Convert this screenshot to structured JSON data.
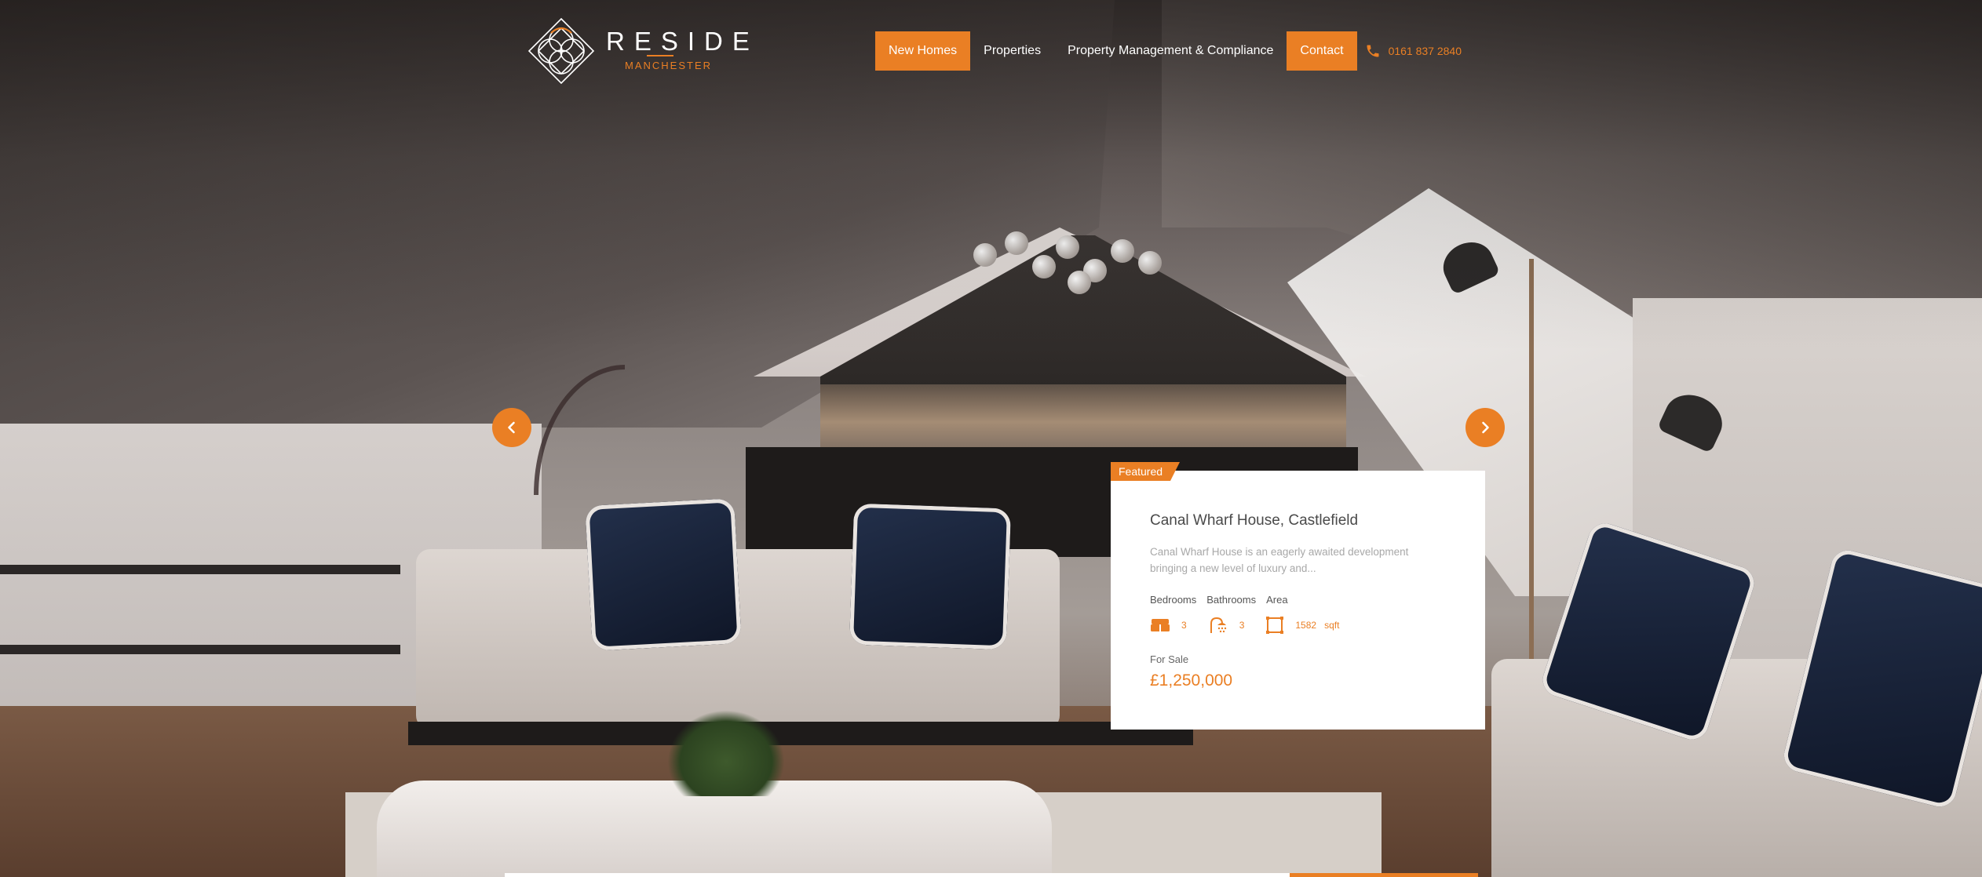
{
  "brand": {
    "name": "RESIDE",
    "tagline": "MANCHESTER",
    "accent_color": "#ea7f24"
  },
  "nav": {
    "items": [
      {
        "label": "New Homes",
        "highlight": true
      },
      {
        "label": "Properties",
        "highlight": false
      },
      {
        "label": "Property Management & Compliance",
        "highlight": false
      },
      {
        "label": "Contact",
        "highlight": true
      }
    ],
    "phone": {
      "icon": "phone-icon",
      "number": "0161 837 2840"
    }
  },
  "slider": {
    "prev_icon": "chevron-left-icon",
    "next_icon": "chevron-right-icon"
  },
  "featured": {
    "tag": "Featured",
    "title": "Canal Wharf House, Castlefield",
    "description": "Canal Wharf House is an eagerly awaited development bringing a new level of luxury and...",
    "labels": {
      "bedrooms": "Bedrooms",
      "bathrooms": "Bathrooms",
      "area": "Area"
    },
    "bedrooms": "3",
    "bathrooms": "3",
    "area": "1582",
    "area_unit": "sqft",
    "status": "For Sale",
    "price": "£1,250,000"
  }
}
